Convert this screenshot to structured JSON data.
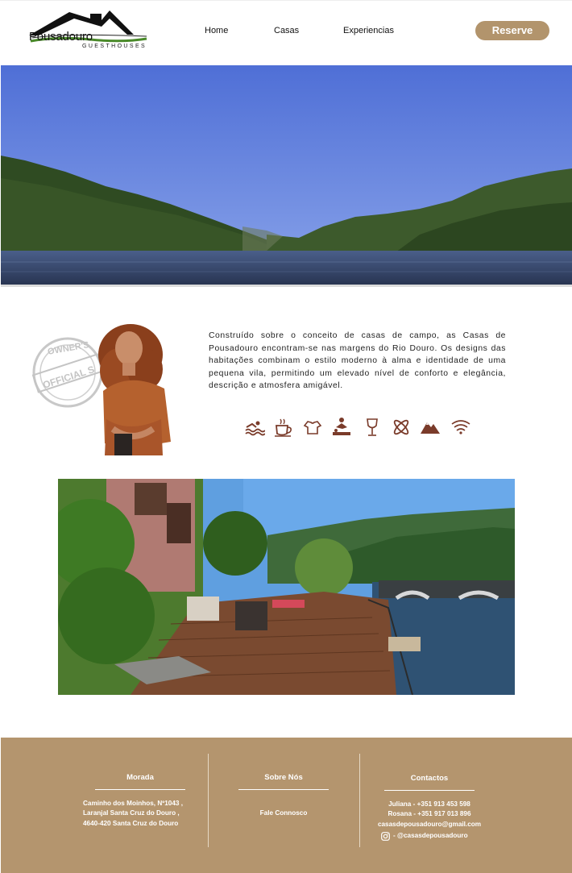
{
  "header": {
    "logo_text": "Pousadouro",
    "logo_subtitle": "GUESTHOUSES",
    "nav": [
      "Home",
      "Casas",
      "Experiencias"
    ],
    "reserve_label": "Reserve"
  },
  "about": {
    "stamp_text": "OWNER'S OFFICIAL SEAL",
    "paragraph": "Construído sobre o conceito de casas de campo, as Casas de Pousadouro encontram-se nas margens do Rio Douro. Os designs das habitações combinam o estilo moderno à alma e identidade de uma pequena vila, permitindo um elevado nível de conforto e elegância, descrição e atmosfera amigável.",
    "amenities": [
      "swimming-icon",
      "coffee-cup-icon",
      "tshirt-icon",
      "massage-icon",
      "wine-glass-icon",
      "kayak-icon",
      "mountain-icon",
      "wifi-icon"
    ]
  },
  "footer": {
    "morada": {
      "title": "Morada",
      "lines": [
        "Caminho dos Moinhos, Nº1043 ,",
        "Laranjal Santa Cruz do Douro ,",
        "4640-420 Santa Cruz do Douro"
      ]
    },
    "sobre": {
      "title": "Sobre Nós",
      "link": "Fale Connosco"
    },
    "contactos": {
      "title": "Contactos",
      "lines": [
        "Juliana - +351 913 453 598",
        "Rosana - +351 917 013 896",
        "casasdepousadouro@gmail.com"
      ],
      "instagram": "- @casasdepousadouro"
    }
  },
  "colors": {
    "accent": "#b2946c",
    "footer_bg": "#b4956e",
    "icon_brown": "#7a3b2a"
  }
}
